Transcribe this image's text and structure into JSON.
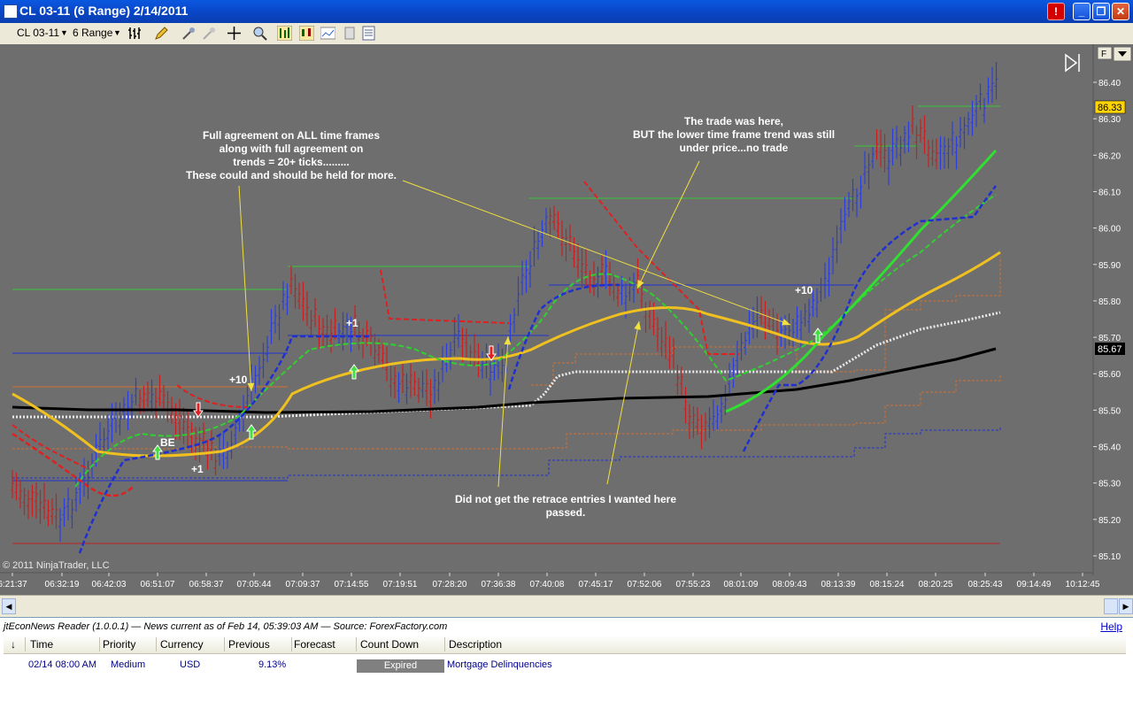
{
  "window": {
    "title": "CL 03-11 (6 Range)  2/14/2011",
    "alert_label": "!"
  },
  "toolbar": {
    "instrument": "CL 03-11",
    "period": "6 Range"
  },
  "chart": {
    "copyright": "© 2011 NinjaTrader, LLC",
    "f_button": "F",
    "price_axis": [
      "86.40",
      "86.30",
      "86.20",
      "86.10",
      "86.00",
      "85.90",
      "85.80",
      "85.70",
      "85.60",
      "85.50",
      "85.40",
      "85.30",
      "85.20",
      "85.10"
    ],
    "price_label_current": "86.33",
    "price_label_ma": "85.67",
    "time_axis": [
      "6:21:37",
      "06:32:19",
      "06:42:03",
      "06:51:07",
      "06:58:37",
      "07:05:44",
      "07:09:37",
      "07:14:55",
      "07:19:51",
      "07:28:20",
      "07:36:38",
      "07:40:08",
      "07:45:17",
      "07:52:06",
      "07:55:23",
      "08:01:09",
      "08:09:43",
      "08:13:39",
      "08:15:24",
      "08:20:25",
      "08:25:43",
      "09:14:49",
      "10:12:45"
    ],
    "annotations": {
      "agreement": [
        "Full agreement on ALL time frames",
        "along with full agreement on",
        "trends = 20+ ticks.........",
        "These could and should be held for more."
      ],
      "trade_here": [
        "The  trade was here,",
        "BUT the lower time frame trend was still",
        "under price...no trade"
      ],
      "retrace": [
        "Did not get the retrace entries I wanted here",
        "passed."
      ]
    },
    "trade_labels": {
      "be": "BE",
      "plus1_a": "+1",
      "plus10_a": "+10",
      "plus1_b": "+1",
      "plus10_b": "+10"
    }
  },
  "news": {
    "title": "jtEconNews Reader (1.0.0.1)  —  News current as of Feb 14, 05:39:03 AM  —  Source: ForexFactory.com",
    "help": "Help",
    "sort_icon": "↓",
    "columns": [
      "Time",
      "Priority",
      "Currency",
      "Previous",
      "Forecast",
      "Count Down",
      "Description"
    ],
    "rows": [
      {
        "time": "02/14 08:00 AM",
        "priority": "Medium",
        "currency": "USD",
        "previous": "9.13%",
        "forecast": "",
        "countdown": "Expired",
        "description": "Mortgage Delinquencies"
      }
    ]
  }
}
